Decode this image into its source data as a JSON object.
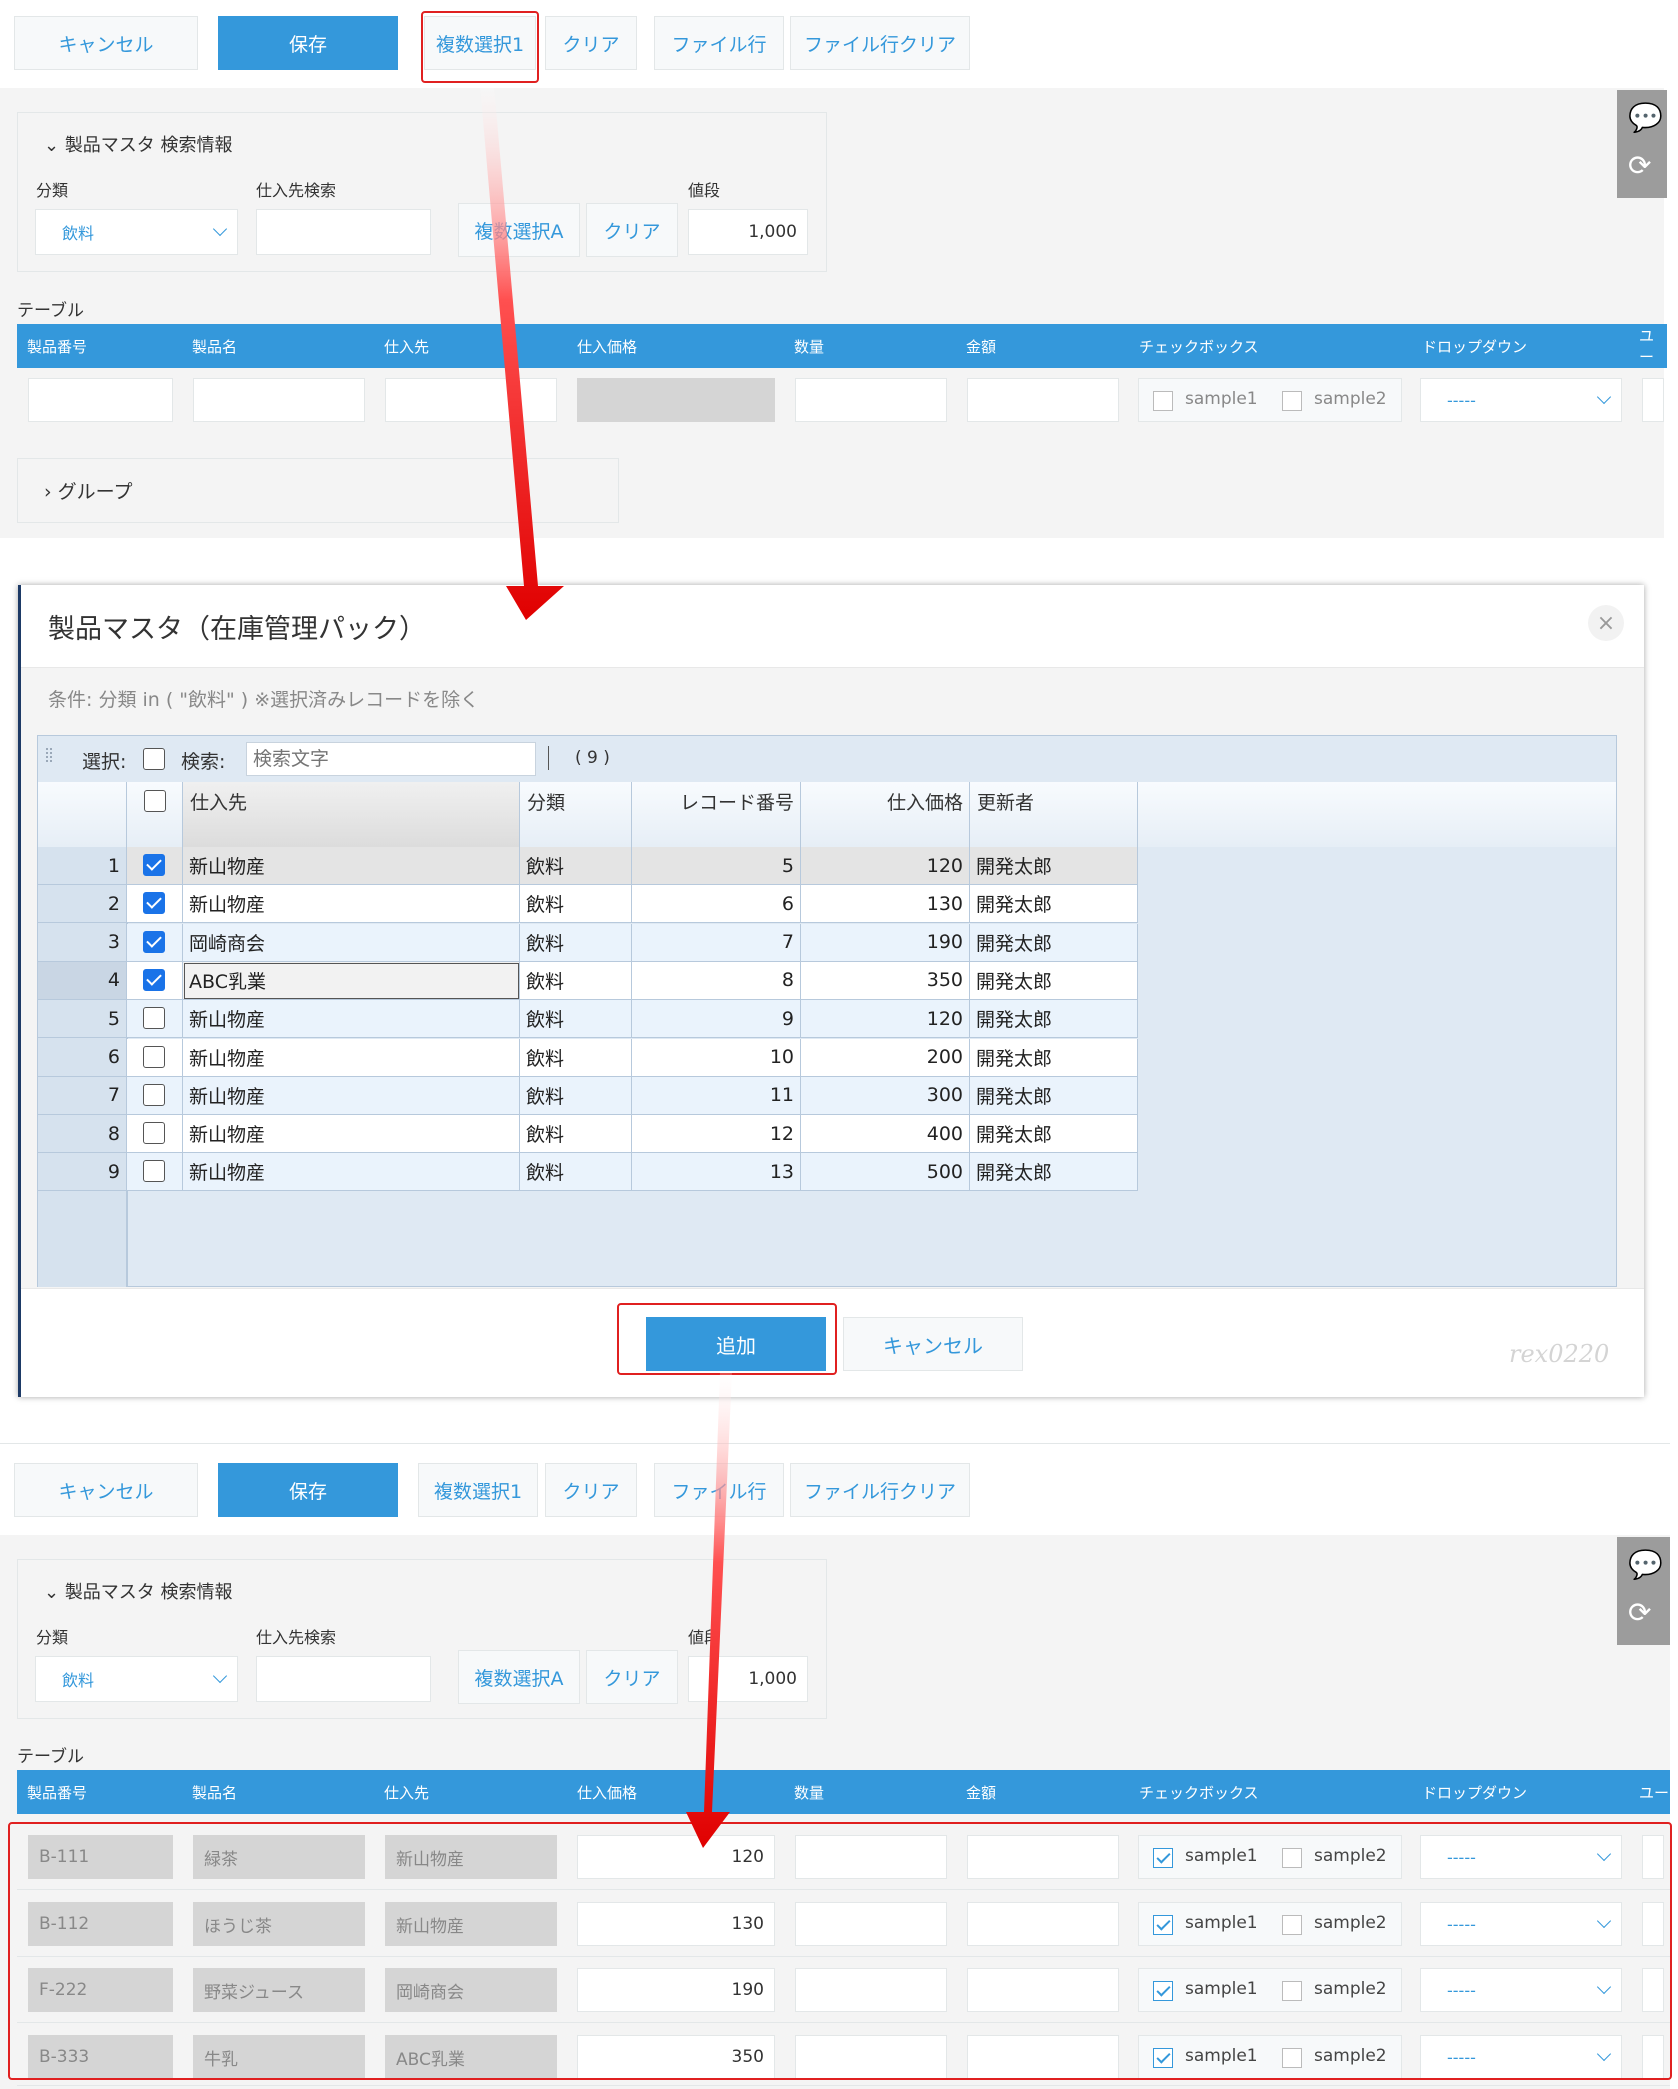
{
  "toolbar": {
    "cancel": "キャンセル",
    "save": "保存",
    "multi_select": "複数選択1",
    "clear": "クリア",
    "file_row": "ファイル行",
    "file_row_clear": "ファイル行クリア"
  },
  "search_panel": {
    "title": "製品マスタ 検索情報",
    "category_label": "分類",
    "category_value": "飲料",
    "supplier_search_label": "仕入先検索",
    "multi_select_a": "複数選択A",
    "clear": "クリア",
    "price_label": "値段",
    "price_value": "1,000"
  },
  "table": {
    "label": "テーブル",
    "columns": [
      "製品番号",
      "製品名",
      "仕入先",
      "仕入価格",
      "数量",
      "金額",
      "チェックボックス",
      "ドロップダウン",
      "ユー"
    ],
    "checkbox_options": [
      "sample1",
      "sample2"
    ],
    "dropdown_value": "-----"
  },
  "group": {
    "label": "グループ"
  },
  "dialog": {
    "title": "製品マスタ（在庫管理パック）",
    "condition": "条件: 分類 in ( \"飲料\" )  ※選択済みレコードを除く",
    "select_label": "選択:",
    "search_label": "検索:",
    "search_placeholder": "検索文字",
    "count": "( 9 )",
    "columns": [
      "仕入先",
      "分類",
      "レコード番号",
      "仕入価格",
      "更新者"
    ],
    "rows": [
      {
        "n": "1",
        "checked": true,
        "supplier": "新山物産",
        "category": "飲料",
        "record": "5",
        "price": "120",
        "updater": "開発太郎"
      },
      {
        "n": "2",
        "checked": true,
        "supplier": "新山物産",
        "category": "飲料",
        "record": "6",
        "price": "130",
        "updater": "開発太郎"
      },
      {
        "n": "3",
        "checked": true,
        "supplier": "岡崎商会",
        "category": "飲料",
        "record": "7",
        "price": "190",
        "updater": "開発太郎"
      },
      {
        "n": "4",
        "checked": true,
        "supplier": "ABC乳業",
        "category": "飲料",
        "record": "8",
        "price": "350",
        "updater": "開発太郎"
      },
      {
        "n": "5",
        "checked": false,
        "supplier": "新山物産",
        "category": "飲料",
        "record": "9",
        "price": "120",
        "updater": "開発太郎"
      },
      {
        "n": "6",
        "checked": false,
        "supplier": "新山物産",
        "category": "飲料",
        "record": "10",
        "price": "200",
        "updater": "開発太郎"
      },
      {
        "n": "7",
        "checked": false,
        "supplier": "新山物産",
        "category": "飲料",
        "record": "11",
        "price": "300",
        "updater": "開発太郎"
      },
      {
        "n": "8",
        "checked": false,
        "supplier": "新山物産",
        "category": "飲料",
        "record": "12",
        "price": "400",
        "updater": "開発太郎"
      },
      {
        "n": "9",
        "checked": false,
        "supplier": "新山物産",
        "category": "飲料",
        "record": "13",
        "price": "500",
        "updater": "開発太郎"
      }
    ],
    "add_button": "追加",
    "cancel_button": "キャンセル",
    "watermark": "rex0220"
  },
  "result_rows": [
    {
      "code": "B-111",
      "name": "緑茶",
      "supplier": "新山物産",
      "price": "120",
      "sample1": true,
      "sample2": false
    },
    {
      "code": "B-112",
      "name": "ほうじ茶",
      "supplier": "新山物産",
      "price": "130",
      "sample1": true,
      "sample2": false
    },
    {
      "code": "F-222",
      "name": "野菜ジュース",
      "supplier": "岡崎商会",
      "price": "190",
      "sample1": true,
      "sample2": false
    },
    {
      "code": "B-333",
      "name": "牛乳",
      "supplier": "ABC乳業",
      "price": "350",
      "sample1": true,
      "sample2": false
    }
  ],
  "colors": {
    "accent": "#3498db",
    "highlight": "#e02020"
  }
}
